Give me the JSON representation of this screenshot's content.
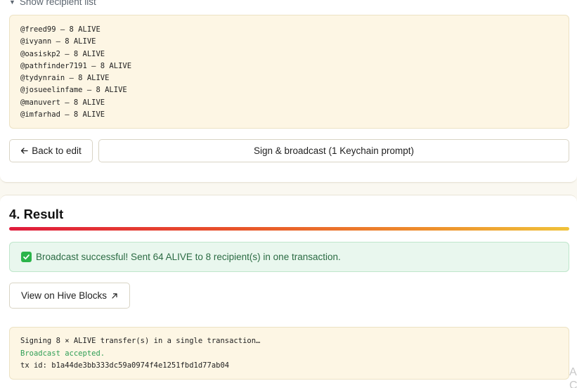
{
  "recipients_toggle": {
    "label": "Show recipient list",
    "icon": "triangle-down-icon"
  },
  "recipients": [
    "@freed99 — 8 ALIVE",
    "@ivyann — 8 ALIVE",
    "@oasiskp2 — 8 ALIVE",
    "@pathfinder7191 — 8 ALIVE",
    "@tydynrain — 8 ALIVE",
    "@josueelinfame — 8 ALIVE",
    "@manuvert — 8 ALIVE",
    "@imfarhad — 8 ALIVE"
  ],
  "actions": {
    "back_label": "Back to edit",
    "back_icon": "arrow-left-icon",
    "sign_label": "Sign & broadcast (1 Keychain prompt)"
  },
  "result": {
    "title": "4. Result",
    "gradient_colors": [
      "#e01b3c",
      "#e8532a",
      "#ee8f2c",
      "#f0c23a"
    ],
    "success_message": "Broadcast successful! Sent 64 ALIVE to 8 recipient(s) in one transaction.",
    "success_icon": "check-box-icon",
    "view_button_label": "View on Hive Blocks",
    "view_button_icon": "external-link-icon"
  },
  "log": {
    "line1": "Signing 8 × ALIVE transfer(s) in a single transaction…",
    "line2": "Broadcast accepted.",
    "line3": "tx id: b1a44de3bb333dc59a0974f4e1251fbd1d77ab04"
  },
  "edge_glyphs": "A\nC"
}
